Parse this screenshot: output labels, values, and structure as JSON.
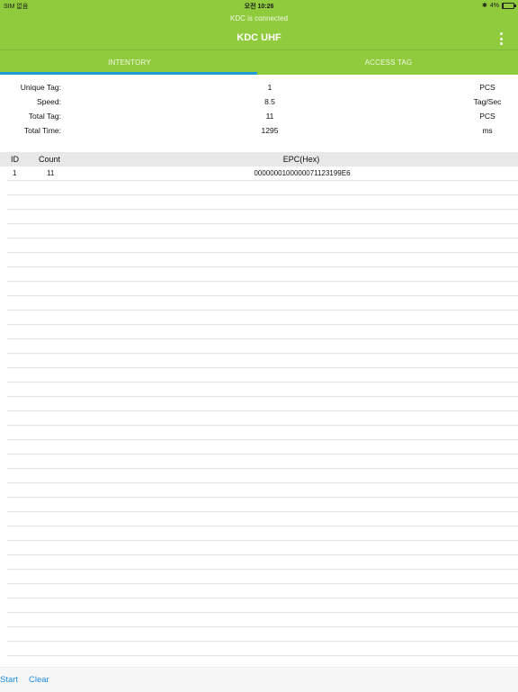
{
  "status_bar": {
    "carrier": "SIM 없음",
    "time": "오전 10:26",
    "bluetooth_symbol": "✱",
    "battery_percent": "4%",
    "battery_level": 0.04
  },
  "header": {
    "connection": "KDC is connected",
    "title": "KDC UHF"
  },
  "tabs": [
    {
      "label": "INTENTORY",
      "active": true
    },
    {
      "label": "ACCESS TAG",
      "active": false
    }
  ],
  "stats": [
    {
      "label": "Unique Tag:",
      "value": "1",
      "unit": "PCS"
    },
    {
      "label": "Speed:",
      "value": "8.5",
      "unit": "Tag/Sec"
    },
    {
      "label": "Total Tag:",
      "value": "11",
      "unit": "PCS"
    },
    {
      "label": "Total Time:",
      "value": "1295",
      "unit": "ms"
    }
  ],
  "table": {
    "headers": {
      "id": "ID",
      "count": "Count",
      "epc": "EPC(Hex)"
    },
    "rows": [
      {
        "id": "1",
        "count": "11",
        "epc": "000000010000007112319 9E6"
      }
    ]
  },
  "footer": {
    "start_label": "Start",
    "clear_label": "Clear"
  },
  "colors": {
    "header_bg": "#8fcb3c",
    "tab_indicator": "#1f9ad6",
    "button_text": "#1f8de0"
  }
}
